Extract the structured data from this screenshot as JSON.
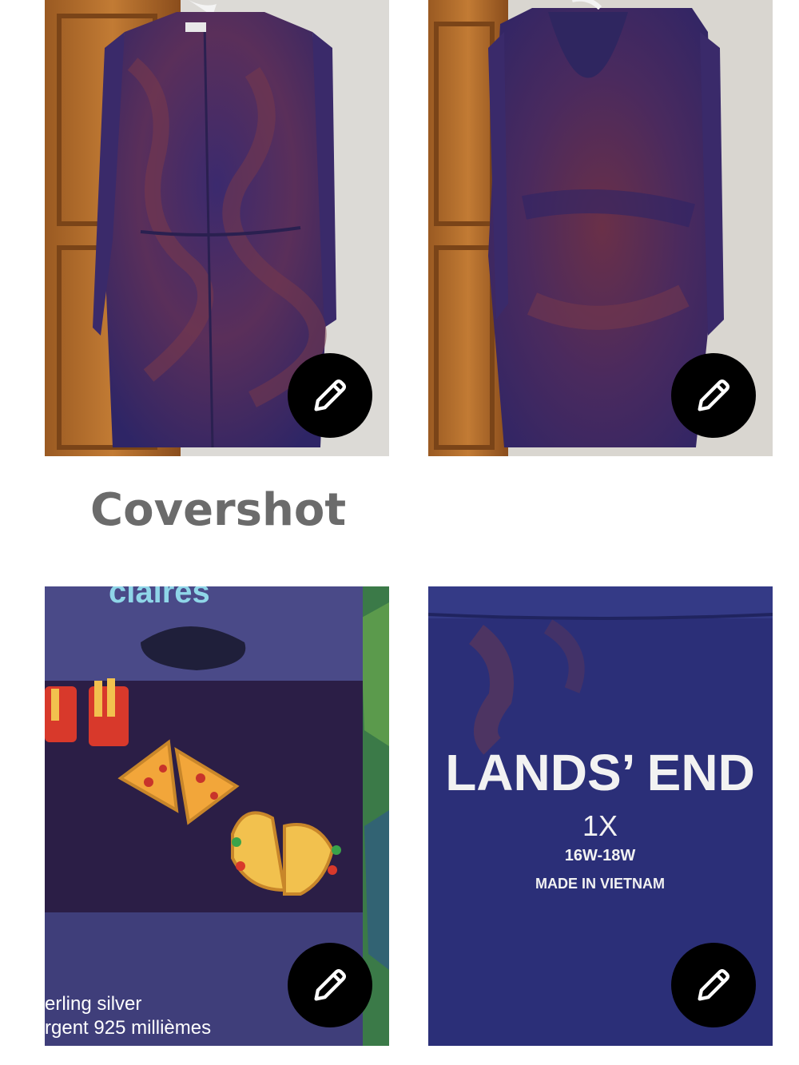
{
  "photos": [
    {
      "name": "front-view",
      "edit_icon": "pencil-icon"
    },
    {
      "name": "back-view",
      "edit_icon": "pencil-icon"
    },
    {
      "name": "earring-card",
      "edit_icon": "pencil-icon",
      "text_lines": [
        "claires",
        "erling silver",
        "rgent 925 millièmes"
      ]
    },
    {
      "name": "brand-tag",
      "edit_icon": "pencil-icon",
      "text_lines": [
        "LANDS' END",
        "1X",
        "16W-18W",
        "MADE IN VIETNAM"
      ]
    }
  ],
  "labels": {
    "covershot": "Covershot"
  },
  "colors": {
    "edit_button_bg": "#000000",
    "edit_icon": "#ffffff",
    "label_text": "#6b6b6b"
  }
}
